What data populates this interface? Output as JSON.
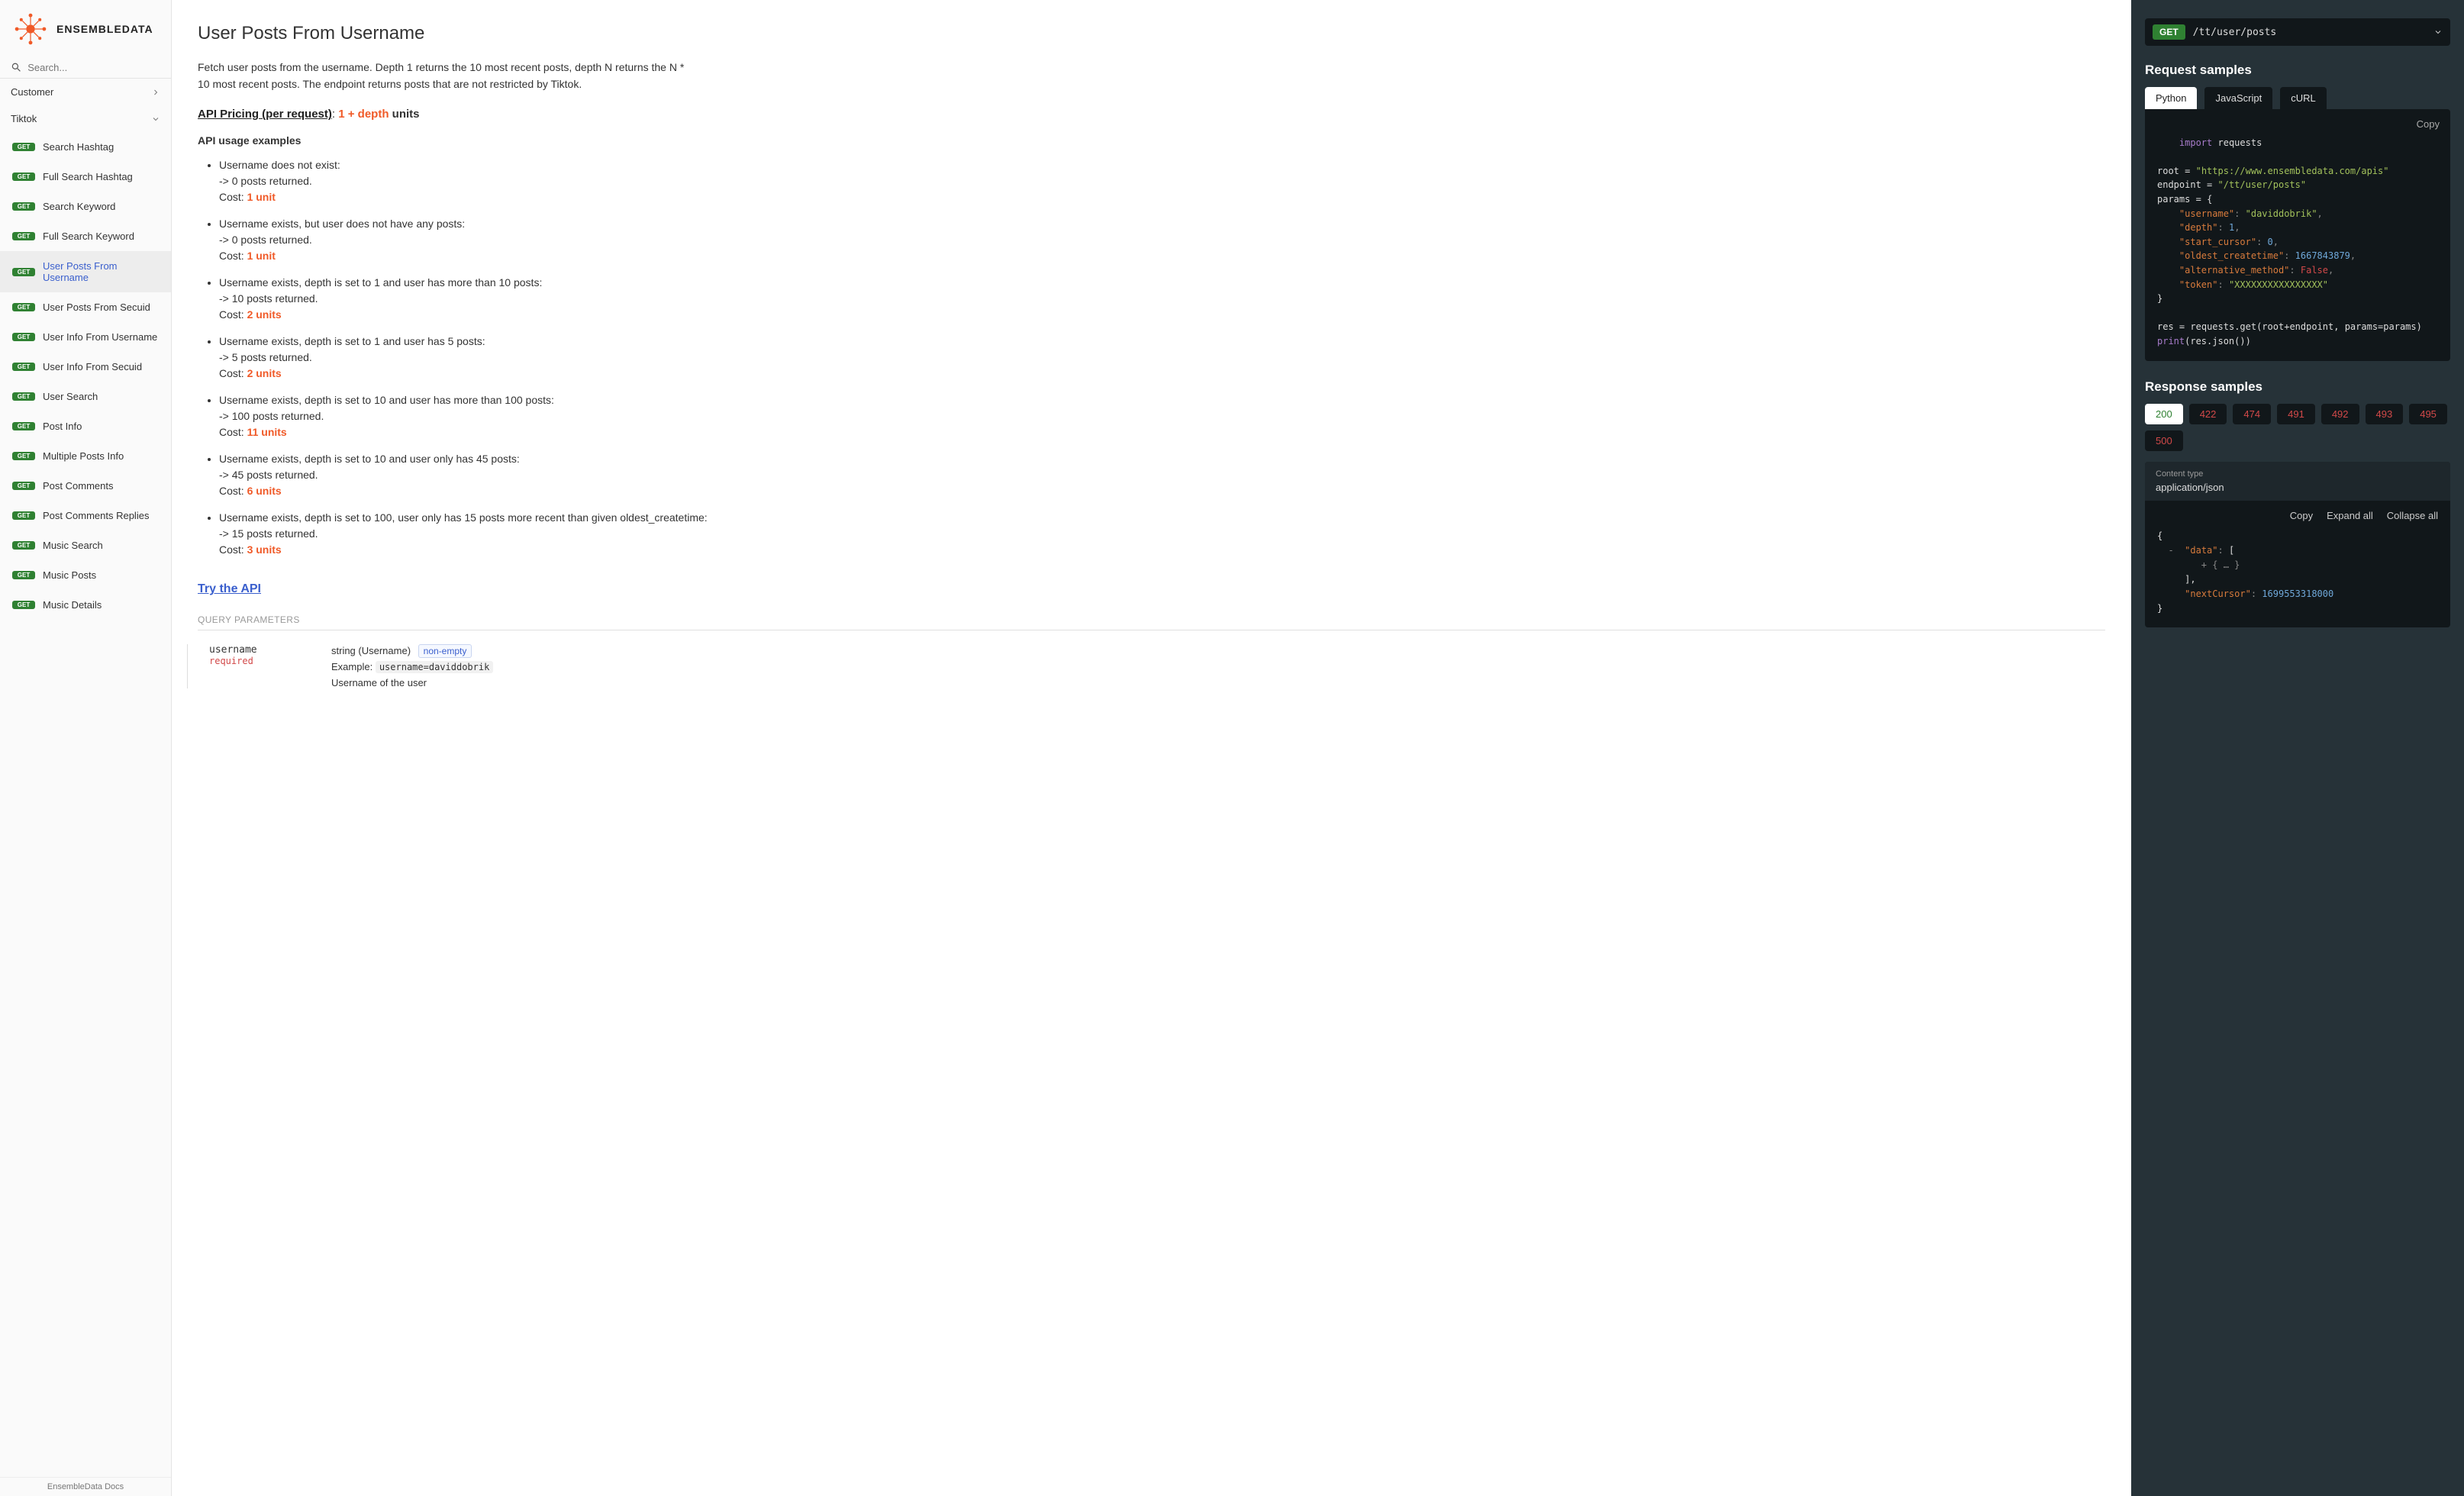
{
  "brand": "ENSEMBLEDATA",
  "search": {
    "placeholder": "Search..."
  },
  "nav_groups": [
    {
      "label": "Customer",
      "expanded": false
    },
    {
      "label": "Tiktok",
      "expanded": true
    }
  ],
  "nav_items": [
    {
      "method": "GET",
      "label": "Search Hashtag"
    },
    {
      "method": "GET",
      "label": "Full Search Hashtag"
    },
    {
      "method": "GET",
      "label": "Search Keyword"
    },
    {
      "method": "GET",
      "label": "Full Search Keyword"
    },
    {
      "method": "GET",
      "label": "User Posts From Username",
      "active": true
    },
    {
      "method": "GET",
      "label": "User Posts From Secuid"
    },
    {
      "method": "GET",
      "label": "User Info From Username"
    },
    {
      "method": "GET",
      "label": "User Info From Secuid"
    },
    {
      "method": "GET",
      "label": "User Search"
    },
    {
      "method": "GET",
      "label": "Post Info"
    },
    {
      "method": "GET",
      "label": "Multiple Posts Info"
    },
    {
      "method": "GET",
      "label": "Post Comments"
    },
    {
      "method": "GET",
      "label": "Post Comments Replies"
    },
    {
      "method": "GET",
      "label": "Music Search"
    },
    {
      "method": "GET",
      "label": "Music Posts"
    },
    {
      "method": "GET",
      "label": "Music Details"
    }
  ],
  "footer": "EnsembleData Docs",
  "page": {
    "title": "User Posts From Username",
    "description": "Fetch user posts from the username. Depth 1 returns the 10 most recent posts, depth N returns the N * 10 most recent posts. The endpoint returns posts that are not restricted by Tiktok.",
    "pricing_label": "API Pricing (per request)",
    "pricing_value": "1 + depth",
    "pricing_suffix": "units",
    "usage_h": "API usage examples",
    "examples": [
      {
        "t": "Username does not exist:",
        "r": "-> 0 posts returned.",
        "c": "Cost: ",
        "cv": "1 unit"
      },
      {
        "t": "Username exists, but user does not have any posts:",
        "r": "-> 0 posts returned.",
        "c": "Cost: ",
        "cv": "1 unit"
      },
      {
        "t": "Username exists, depth is set to 1 and user has more than 10 posts:",
        "r": "-> 10 posts returned.",
        "c": "Cost: ",
        "cv": "2 units"
      },
      {
        "t": "Username exists, depth is set to 1 and user has 5 posts:",
        "r": "-> 5 posts returned.",
        "c": "Cost: ",
        "cv": "2 units"
      },
      {
        "t": "Username exists, depth is set to 10 and user has more than 100 posts:",
        "r": "-> 100 posts returned.",
        "c": "Cost: ",
        "cv": "11 units"
      },
      {
        "t": "Username exists, depth is set to 10 and user only has 45 posts:",
        "r": "-> 45 posts returned.",
        "c": "Cost: ",
        "cv": "6 units"
      },
      {
        "t": "Username exists, depth is set to 100, user only has 15 posts more recent than given oldest_createtime:",
        "r": "-> 15 posts returned.",
        "c": "Cost: ",
        "cv": "3 units"
      }
    ],
    "try_api": "Try the API",
    "qp_title": "QUERY PARAMETERS",
    "params": [
      {
        "name": "username",
        "required": "required",
        "type": "string (Username)",
        "flag": "non-empty",
        "example_label": "Example:",
        "example": "username=daviddobrik",
        "desc": "Username of the user"
      }
    ]
  },
  "right": {
    "endpoint": {
      "method": "GET",
      "path": "/tt/user/posts"
    },
    "req_h": "Request samples",
    "req_tabs": [
      "Python",
      "JavaScript",
      "cURL"
    ],
    "code": {
      "copy": "Copy",
      "import_kw": "import",
      "import_mod": "requests",
      "root_var": "root",
      "root_val": "\"https://www.ensembledata.com/apis\"",
      "endpoint_var": "endpoint",
      "endpoint_val": "\"/tt/user/posts\"",
      "params_var": "params",
      "kv": [
        {
          "k": "\"username\"",
          "v": "\"daviddobrik\"",
          "type": "str"
        },
        {
          "k": "\"depth\"",
          "v": "1",
          "type": "num"
        },
        {
          "k": "\"start_cursor\"",
          "v": "0",
          "type": "num"
        },
        {
          "k": "\"oldest_createtime\"",
          "v": "1667843879",
          "type": "num"
        },
        {
          "k": "\"alternative_method\"",
          "v": "False",
          "type": "bool"
        },
        {
          "k": "\"token\"",
          "v": "\"XXXXXXXXXXXXXXXX\"",
          "type": "str"
        }
      ],
      "res_line1a": "res",
      "res_line1b": "requests.get(root",
      "res_line1c": "endpoint, params",
      "res_line1d": "params)",
      "res_line2": "print",
      "res_line2b": "(res.json())"
    },
    "resp_h": "Response samples",
    "status": [
      "200",
      "422",
      "474",
      "491",
      "492",
      "493",
      "495",
      "500"
    ],
    "resp_meta": {
      "label": "Content type",
      "value": "application/json"
    },
    "resp_actions": [
      "Copy",
      "Expand all",
      "Collapse all"
    ],
    "resp_json": {
      "open": "{",
      "data_key": "\"data\"",
      "open_arr": "[",
      "inner": "+ { … }",
      "close_arr": "],",
      "next_key": "\"nextCursor\"",
      "next_val": "1699553318000",
      "close": "}"
    }
  }
}
